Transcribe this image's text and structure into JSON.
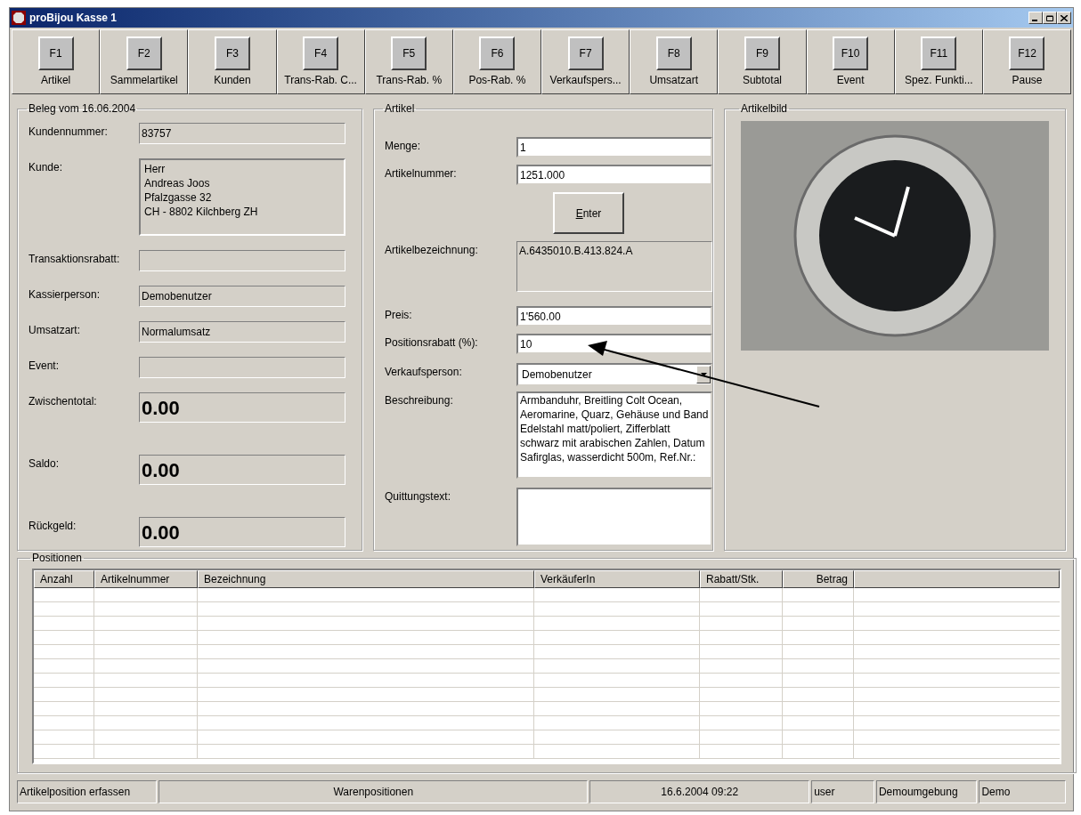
{
  "window": {
    "title": "proBijou Kasse 1"
  },
  "toolbar": [
    {
      "key": "F1",
      "label": "Artikel"
    },
    {
      "key": "F2",
      "label": "Sammelartikel"
    },
    {
      "key": "F3",
      "label": "Kunden"
    },
    {
      "key": "F4",
      "label": "Trans-Rab. C..."
    },
    {
      "key": "F5",
      "label": "Trans-Rab. %"
    },
    {
      "key": "F6",
      "label": "Pos-Rab. %"
    },
    {
      "key": "F7",
      "label": "Verkaufspers..."
    },
    {
      "key": "F8",
      "label": "Umsatzart"
    },
    {
      "key": "F9",
      "label": "Subtotal"
    },
    {
      "key": "F10",
      "label": "Event"
    },
    {
      "key": "F11",
      "label": "Spez. Funkti..."
    },
    {
      "key": "F12",
      "label": "Pause"
    }
  ],
  "beleg": {
    "title": "Beleg vom 16.06.2004",
    "fields": [
      {
        "kind": "field",
        "label": "Kundennummer:",
        "value": "83757"
      },
      {
        "kind": "multiline",
        "label": "Kunde:",
        "lines": [
          "Herr",
          "Andreas Joos",
          "Pfalzgasse 32",
          "CH - 8802 Kilchberg ZH"
        ]
      },
      {
        "kind": "field",
        "label": "Transaktionsrabatt:"
      },
      {
        "kind": "field",
        "label": "Kassierperson:",
        "value": "Demobenutzer"
      },
      {
        "kind": "field",
        "label": "Umsatzart:",
        "value": "Normalumsatz"
      },
      {
        "kind": "field",
        "label": "Event:"
      },
      {
        "kind": "total",
        "label": "Zwischentotal:",
        "value": "0.00"
      },
      {
        "kind": "total",
        "label": "Saldo:",
        "value": "0.00"
      },
      {
        "kind": "total",
        "label": "Rückgeld:",
        "value": "0.00"
      }
    ]
  },
  "artikel": {
    "title": "Artikel",
    "fields": [
      {
        "kind": "input",
        "label": "Menge:",
        "value": "1"
      },
      {
        "kind": "input",
        "label": "Artikelnummer:",
        "value": "1251.000"
      },
      {
        "kind": "button",
        "label": "Enter"
      },
      {
        "kind": "readonly",
        "label": "Artikelbezeichnung:",
        "value": "A.6435010.B.413.824.A"
      },
      {
        "kind": "input",
        "label": "Preis:",
        "value": "1'560.00"
      },
      {
        "kind": "input",
        "label": "Positionsrabatt (%):",
        "value": "10"
      },
      {
        "kind": "select",
        "label": "Verkaufsperson:",
        "value": "Demobenutzer"
      },
      {
        "kind": "textarea",
        "label": "Beschreibung:",
        "value": "Armbanduhr, Breitling Colt Ocean, Aeromarine, Quarz, Gehäuse und Band Edelstahl matt/poliert, Zifferblatt schwarz mit arabischen Zahlen, Datum Safirglas, wasserdicht 500m, Ref.Nr.:"
      },
      {
        "kind": "textarea",
        "label": "Quittungstext:"
      }
    ]
  },
  "artikelbild": {
    "title": "Artikelbild"
  },
  "positionen": {
    "title": "Positionen",
    "columns": [
      "Anzahl",
      "Artikelnummer",
      "Bezeichnung",
      "VerkäuferIn",
      "Rabatt/Stk.",
      "Betrag"
    ]
  },
  "status_bar": [
    "Artikelposition erfassen",
    "Warenpositionen",
    "16.6.2004 09:22",
    "user",
    "Demoumgebung",
    "Demo"
  ]
}
